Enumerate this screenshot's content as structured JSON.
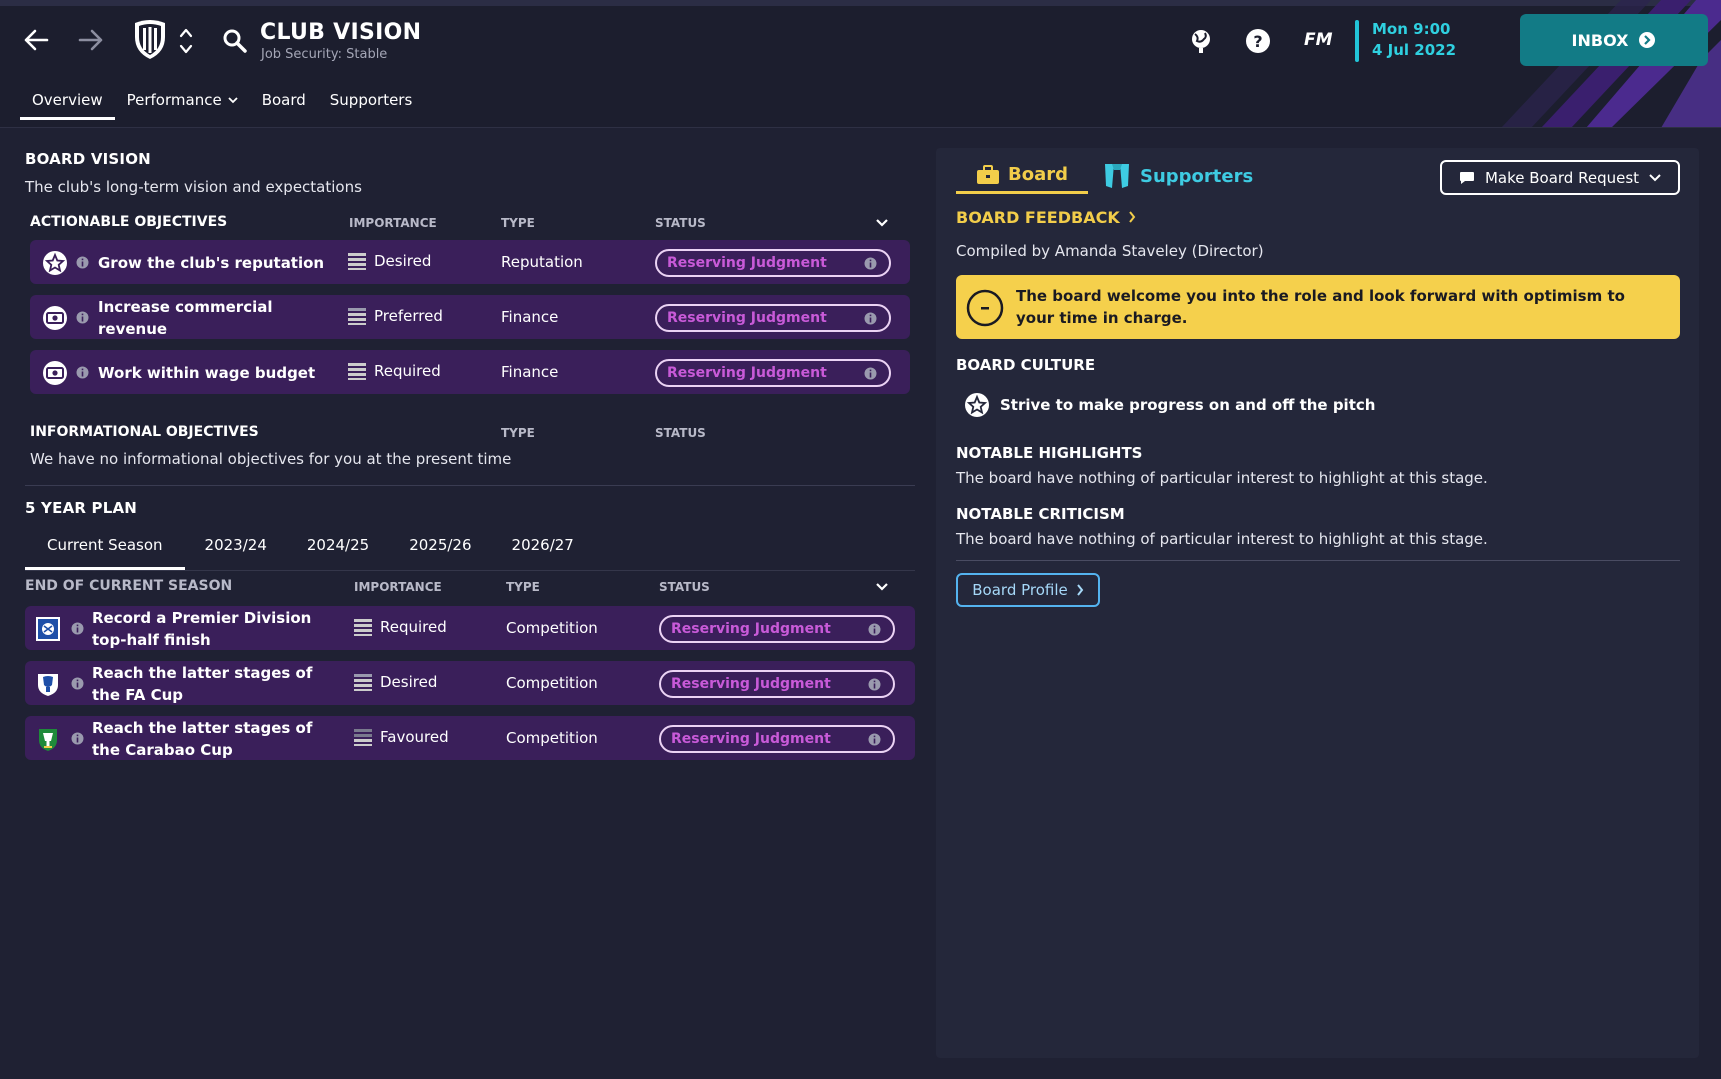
{
  "header": {
    "title": "CLUB VISION",
    "subtitle": "Job Security: Stable",
    "fm_label": "FM",
    "date_time": "Mon 9:00",
    "date_day": "4 Jul 2022",
    "inbox_label": "INBOX",
    "tabs": [
      {
        "label": "Overview"
      },
      {
        "label": "Performance"
      },
      {
        "label": "Board"
      },
      {
        "label": "Supporters"
      }
    ]
  },
  "board_vision": {
    "title": "BOARD VISION",
    "subtitle": "The club's long-term vision and expectations",
    "actionable": {
      "heading": "ACTIONABLE OBJECTIVES",
      "col_importance": "IMPORTANCE",
      "col_type": "TYPE",
      "col_status": "STATUS",
      "rows": [
        {
          "title": "Grow the club's reputation",
          "importance": "Desired",
          "type": "Reputation",
          "status": "Reserving Judgment",
          "icon": "star-icon"
        },
        {
          "title": "Increase commercial revenue",
          "importance": "Preferred",
          "type": "Finance",
          "status": "Reserving Judgment",
          "icon": "money-icon"
        },
        {
          "title": "Work within wage budget",
          "importance": "Required",
          "type": "Finance",
          "status": "Reserving Judgment",
          "icon": "money-icon"
        }
      ]
    },
    "informational": {
      "heading": "INFORMATIONAL OBJECTIVES",
      "col_type": "TYPE",
      "col_status": "STATUS",
      "empty_text": "We have no informational objectives for you at the present time"
    }
  },
  "five_year_plan": {
    "title": "5 YEAR PLAN",
    "tabs": [
      "Current Season",
      "2023/24",
      "2024/25",
      "2025/26",
      "2026/27"
    ],
    "section": {
      "heading": "END OF CURRENT SEASON",
      "col_importance": "IMPORTANCE",
      "col_type": "TYPE",
      "col_status": "STATUS",
      "rows": [
        {
          "title": "Record a Premier Division top-half finish",
          "importance": "Required",
          "type": "Competition",
          "status": "Reserving Judgment",
          "icon": "premier-division-logo"
        },
        {
          "title": "Reach the latter stages of the FA Cup",
          "importance": "Desired",
          "type": "Competition",
          "status": "Reserving Judgment",
          "icon": "fa-cup-logo"
        },
        {
          "title": "Reach the latter stages of the Carabao Cup",
          "importance": "Favoured",
          "type": "Competition",
          "status": "Reserving Judgment",
          "icon": "carabao-cup-logo"
        }
      ]
    }
  },
  "right_panel": {
    "tab_board": "Board",
    "tab_supporters": "Supporters",
    "request_button": "Make Board Request",
    "feedback_link": "BOARD FEEDBACK",
    "compiled_by": "Compiled by Amanda Staveley (Director)",
    "feedback_message": "The board welcome you into the role and look forward with optimism to your time in charge.",
    "culture_heading": "BOARD CULTURE",
    "culture_item": "Strive to make progress on and off the pitch",
    "highlights_heading": "NOTABLE HIGHLIGHTS",
    "highlights_text": "The board have nothing of particular interest to highlight at this stage.",
    "criticism_heading": "NOTABLE CRITICISM",
    "criticism_text": "The board have nothing of particular interest to highlight at this stage.",
    "profile_button": "Board Profile"
  },
  "colors": {
    "background": "#1f2133",
    "row": "#3a1f5a",
    "status_text": "#c85ad8",
    "board_accent": "#f2cd4a",
    "supporters_accent": "#3ecbe2",
    "inbox": "#127b86"
  }
}
